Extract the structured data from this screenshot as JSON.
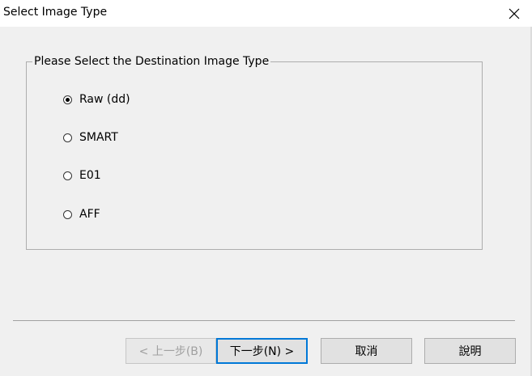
{
  "window": {
    "title": "Select Image Type"
  },
  "group": {
    "legend": "Please Select the Destination Image Type",
    "options": [
      {
        "label": "Raw (dd)",
        "checked": true
      },
      {
        "label": "SMART",
        "checked": false
      },
      {
        "label": "E01",
        "checked": false
      },
      {
        "label": "AFF",
        "checked": false
      }
    ]
  },
  "buttons": {
    "back": "< 上一步(B)",
    "next": "下一步(N) >",
    "cancel": "取消",
    "help": "說明"
  },
  "icons": {
    "close": "close-icon"
  }
}
